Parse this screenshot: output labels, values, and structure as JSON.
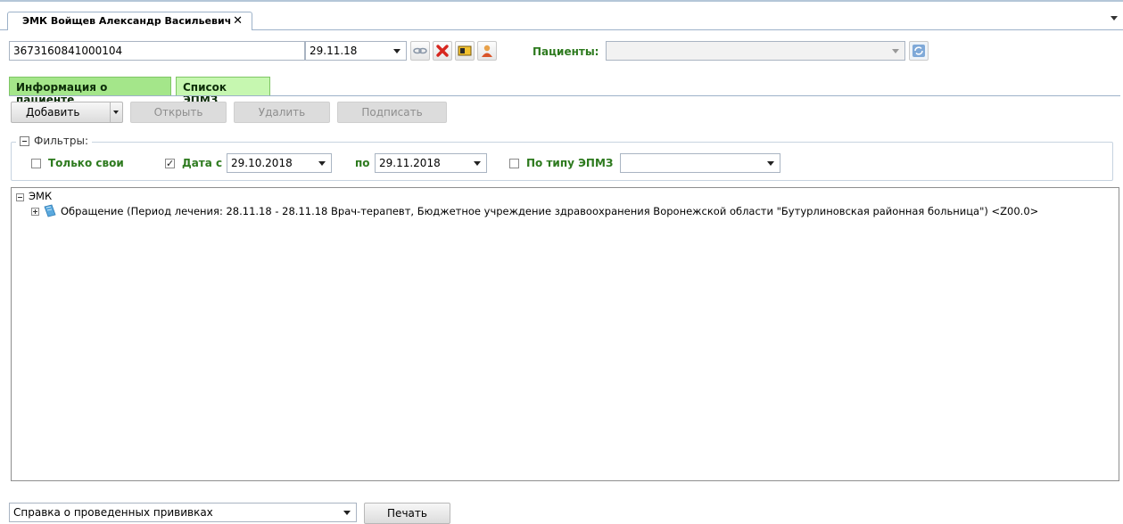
{
  "window": {
    "tab_title": "ЭМК Войщев Александр Васильевич",
    "tab_close": "✕"
  },
  "header": {
    "card_number": "3673160841000104",
    "date_value": "29.11.18",
    "patients_label": "Пациенты:",
    "patients_value": ""
  },
  "tabs": [
    {
      "label": "Информация о пациенте",
      "active": false
    },
    {
      "label": "Список ЭПМЗ",
      "active": true
    }
  ],
  "toolbar": {
    "add_label": "Добавить",
    "open_label": "Открыть",
    "delete_label": "Удалить",
    "sign_label": "Подписать"
  },
  "filters": {
    "legend": "Фильтры:",
    "only_own_label": "Только свои",
    "only_own_checked": false,
    "date_from_label": "Дата с",
    "date_from_checked": true,
    "date_from_value": "29.10.2018",
    "to_label": "по",
    "date_to_value": "29.11.2018",
    "by_type_label": "По типу ЭПМЗ",
    "by_type_checked": false,
    "type_value": ""
  },
  "tree": {
    "root_label": "ЭМК",
    "items": [
      {
        "label": "Обращение (Период лечения: 28.11.18 - 28.11.18 Врач-терапевт, Бюджетное учреждение здравоохранения Воронежской области \"Бутурлиновская районная больница\") <Z00.0>"
      }
    ]
  },
  "footer": {
    "report_value": "Справка о проведенных прививках",
    "print_label": "Печать"
  },
  "colors": {
    "accent_green": "#2d7a1e",
    "tab_green": "#a4e68a"
  }
}
